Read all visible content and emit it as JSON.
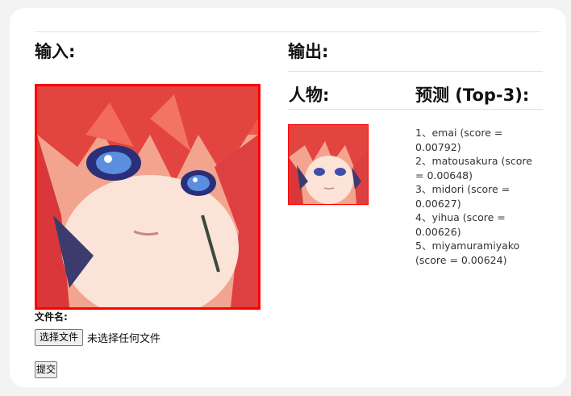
{
  "input": {
    "heading": "输入:",
    "filename_label": "文件名:",
    "choose_file_label": "选择文件",
    "no_file_text": "未选择任何文件",
    "submit_label": "提交"
  },
  "output": {
    "heading": "输出:",
    "col_character": "人物:",
    "col_prediction": "预测 (Top-3):",
    "predictions": [
      {
        "rank": "1",
        "text": "1、emai (score = 0.00792)"
      },
      {
        "rank": "2",
        "text": "2、matousakura (score = 0.00648)"
      },
      {
        "rank": "3",
        "text": "3、midori (score = 0.00627)"
      },
      {
        "rank": "4",
        "text": "4、yihua (score = 0.00626)"
      },
      {
        "rank": "5",
        "text": "5、miyamuramiyako (score = 0.00624)"
      }
    ]
  },
  "colors": {
    "highlight_border": "#ff0000",
    "card_background": "#ffffff",
    "page_background": "#f3f3f3"
  }
}
